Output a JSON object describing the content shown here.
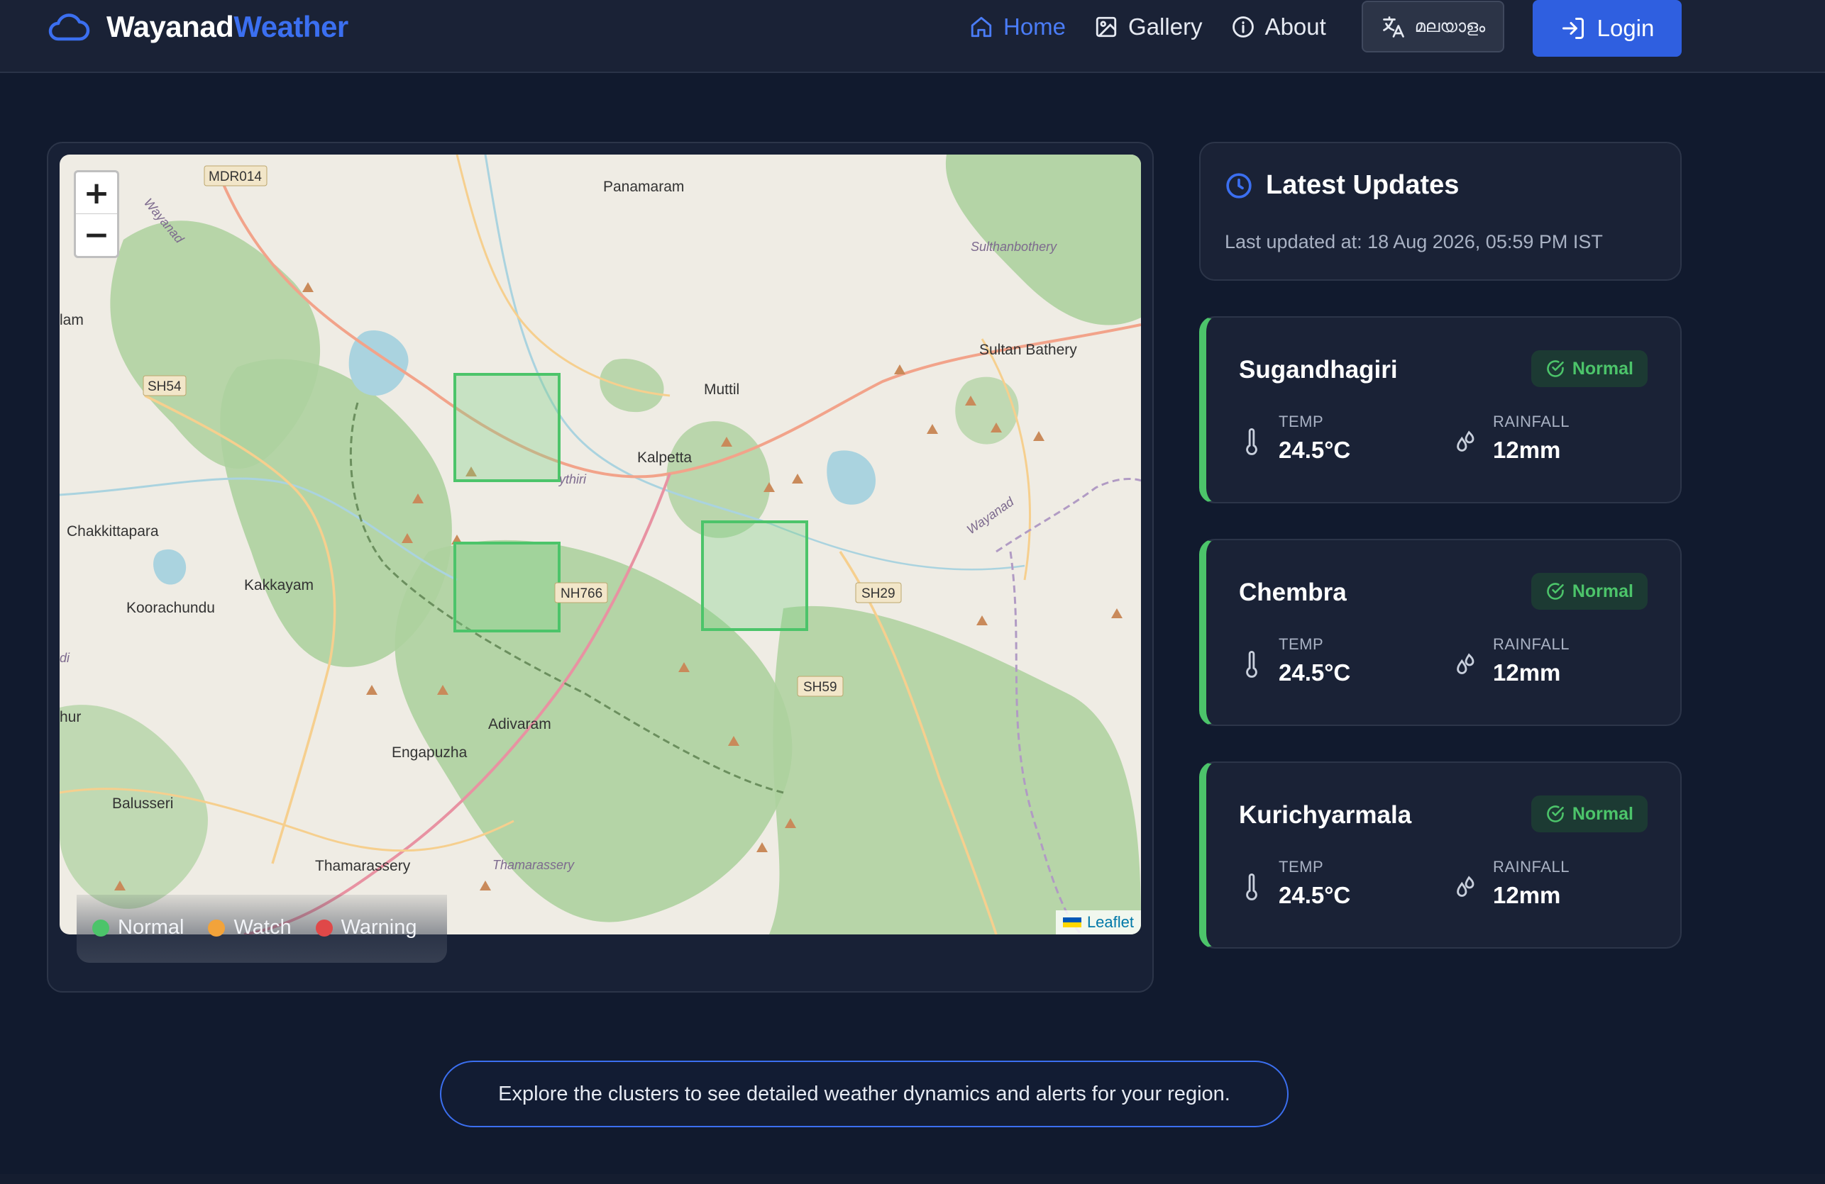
{
  "nav": {
    "brand_part1": "Wayanad",
    "brand_part2": "Weather",
    "links": [
      {
        "label": "Home",
        "icon": "home-icon",
        "active": true
      },
      {
        "label": "Gallery",
        "icon": "gallery-icon",
        "active": false
      },
      {
        "label": "About",
        "icon": "info-icon",
        "active": false
      }
    ],
    "language_label": "മലയാളം",
    "login_label": "Login"
  },
  "map": {
    "zoom_in": "+",
    "zoom_out": "−",
    "attribution": "Leaflet",
    "place_labels": [
      "MDR014",
      "Wayanad",
      "Panamaram",
      "Sulthanbothery",
      "Sultan Bathery",
      "lam",
      "SH54",
      "Muttil",
      "Kalpetta",
      "ythiri",
      "Wayanad",
      "Chakkittapara",
      "Kakkayam",
      "Koorachundu",
      "NH766",
      "SH29",
      "SH59",
      "di",
      "hur",
      "Adivaram",
      "Engapuzha",
      "Balusseri",
      "Thamarassery",
      "Thamarassery"
    ],
    "legend": [
      {
        "label": "Normal",
        "color": "#4cc46a"
      },
      {
        "label": "Watch",
        "color": "#f2a33a"
      },
      {
        "label": "Warning",
        "color": "#e04848"
      }
    ]
  },
  "updates": {
    "title": "Latest Updates",
    "last_updated": "Last updated at: 18 Aug 2026, 05:59 PM IST"
  },
  "clusters": [
    {
      "name": "Sugandhagiri",
      "status": "Normal",
      "temp_label": "TEMP",
      "temp": "24.5°C",
      "rain_label": "RAINFALL",
      "rain": "12mm"
    },
    {
      "name": "Chembra",
      "status": "Normal",
      "temp_label": "TEMP",
      "temp": "24.5°C",
      "rain_label": "RAINFALL",
      "rain": "12mm"
    },
    {
      "name": "Kurichyarmala",
      "status": "Normal",
      "temp_label": "TEMP",
      "temp": "24.5°C",
      "rain_label": "RAINFALL",
      "rain": "12mm"
    }
  ],
  "explore_text": "Explore the clusters to see detailed weather dynamics and alerts for your region.",
  "colors": {
    "accent": "#3b6ff0",
    "normal": "#4cc46a",
    "background": "#111a2e"
  }
}
